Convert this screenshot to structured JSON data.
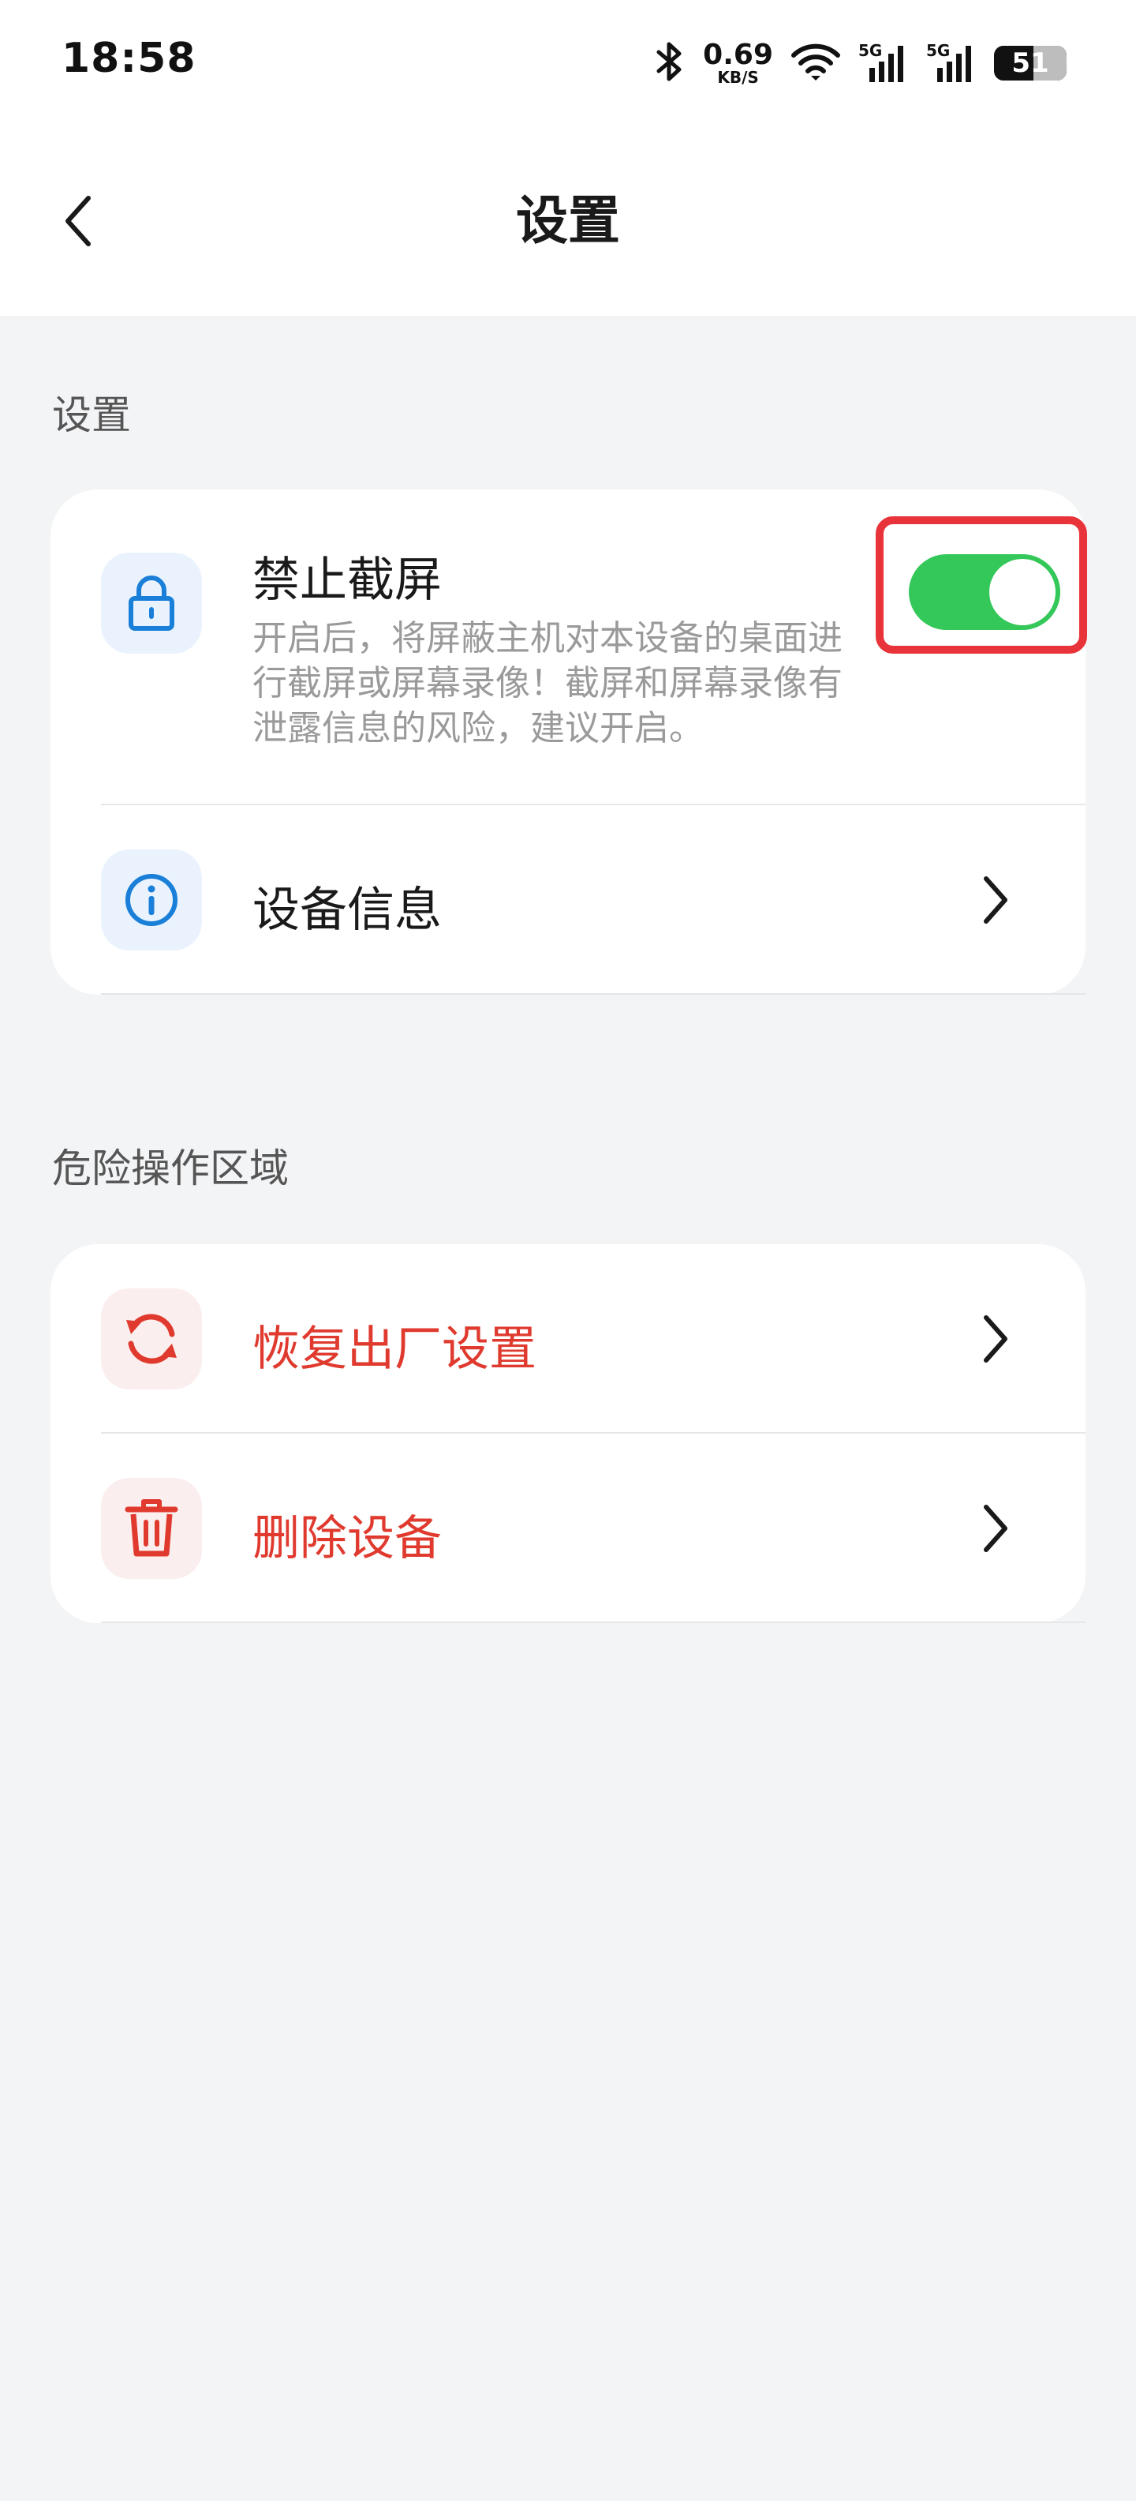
{
  "status_bar": {
    "time": "18:58",
    "net_speed_value": "0.69",
    "net_speed_unit": "KB/S",
    "signal_1_label": "5G",
    "signal_2_label": "5G",
    "battery_level": "51",
    "icons": [
      "bluetooth-icon",
      "wifi-icon",
      "signal-icon",
      "signal-icon",
      "battery-icon"
    ]
  },
  "nav": {
    "title": "设置",
    "back_icon": "chevron-left-icon"
  },
  "settings_section": {
    "label": "设置",
    "items": [
      {
        "title": "禁止截屏",
        "description": "开启后，将屏蔽主机对本设备的桌面进行截屏或屏幕录像！截屏和屏幕录像有泄露信息的风险，建议开启。",
        "icon": "lock-icon",
        "toggle_on": true
      },
      {
        "title": "设备信息",
        "icon": "info-icon"
      }
    ]
  },
  "danger_section": {
    "label": "危险操作区域",
    "items": [
      {
        "title": "恢复出厂设置",
        "icon": "refresh-icon"
      },
      {
        "title": "删除设备",
        "icon": "trash-icon"
      }
    ]
  },
  "colors": {
    "accent_blue": "#1a7fd8",
    "danger_red": "#e03a2f",
    "toggle_green": "#34c759",
    "highlight_red": "#e8333a",
    "background": "#f3f4f6"
  }
}
